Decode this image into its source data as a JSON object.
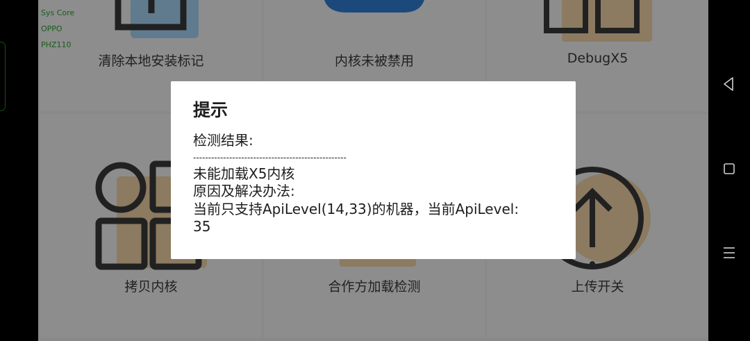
{
  "device_info": [
    "Sys Core",
    "OPPO",
    "PHZ110"
  ],
  "tiles": [
    {
      "label": "清除本地安装标记",
      "icon": "plug-icon"
    },
    {
      "label": "内核未被禁用",
      "icon": "toggle-icon"
    },
    {
      "label": "DebugX5",
      "icon": "debug-icon"
    },
    {
      "label": "拷贝内核",
      "icon": "grid-icon"
    },
    {
      "label": "合作方加载检测",
      "icon": "check-icon"
    },
    {
      "label": "上传开关",
      "icon": "upload-icon"
    }
  ],
  "dialog": {
    "title": "提示",
    "line1": "检测结果:",
    "separator": "---------------------------------------------------",
    "line2": "未能加载X5内核",
    "line3": "原因及解决办法:",
    "line4": "当前只支持ApiLevel(14,33)的机器，当前ApiLevel:",
    "line5": "35"
  },
  "colors": {
    "accent_blue": "#2f7fd6",
    "light_blue": "#a8d4f5",
    "tan": "#f1d3a8",
    "icon_dark": "#3a3a3a",
    "device_text": "#2f9e2f"
  },
  "nav": {
    "back": "back-icon",
    "home": "home-icon",
    "recents": "recents-icon"
  }
}
